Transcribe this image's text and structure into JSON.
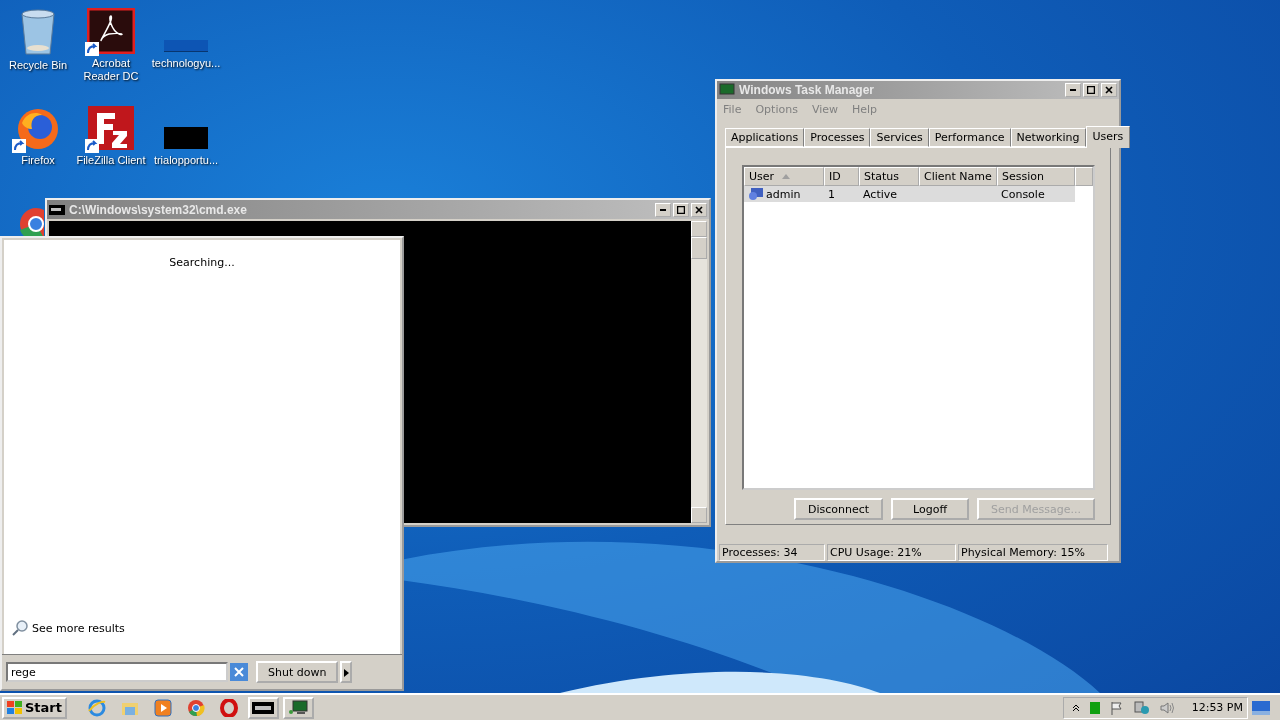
{
  "desktop_icons": [
    {
      "label": "Recycle Bin",
      "kind": "recycle",
      "shortcut": false
    },
    {
      "label": "Acrobat Reader DC",
      "kind": "acrobat",
      "shortcut": true
    },
    {
      "label": "technologyu...",
      "kind": "blank",
      "shortcut": false
    },
    {
      "label": "Firefox",
      "kind": "firefox",
      "shortcut": true
    },
    {
      "label": "FileZilla Client",
      "kind": "filezilla",
      "shortcut": true
    },
    {
      "label": "trialopportu...",
      "kind": "dark",
      "shortcut": false
    }
  ],
  "cmd_window": {
    "title": "C:\\Windows\\system32\\cmd.exe"
  },
  "task_manager": {
    "title": "Windows Task Manager",
    "menu": [
      "File",
      "Options",
      "View",
      "Help"
    ],
    "tabs": [
      {
        "label": "Applications",
        "selected": false
      },
      {
        "label": "Processes",
        "selected": false
      },
      {
        "label": "Services",
        "selected": false
      },
      {
        "label": "Performance",
        "selected": false
      },
      {
        "label": "Networking",
        "selected": false
      },
      {
        "label": "Users",
        "selected": true
      }
    ],
    "columns": [
      "User",
      "ID",
      "Status",
      "Client Name",
      "Session"
    ],
    "rows": [
      {
        "user": "admin",
        "id": "1",
        "status": "Active",
        "session": "Console",
        "selected": true
      }
    ],
    "buttons": [
      {
        "label": "Disconnect",
        "disabled": false
      },
      {
        "label": "Logoff",
        "disabled": false
      },
      {
        "label": "Send Message...",
        "disabled": true
      }
    ],
    "status_bar": [
      "Processes: 34",
      "CPU Usage: 21%",
      "Physical Memory: 15%"
    ]
  },
  "start_menu": {
    "status": "Searching...",
    "more_results": "See more results",
    "search": {
      "value": "rege"
    },
    "shutdown": "Shut down"
  },
  "taskbar": {
    "start": "Start",
    "apps": [
      {
        "kind": "ie",
        "open": false
      },
      {
        "kind": "explorer",
        "open": false
      },
      {
        "kind": "media",
        "open": false
      },
      {
        "kind": "chrome",
        "open": false
      },
      {
        "kind": "opera",
        "open": false
      },
      {
        "kind": "cmd",
        "open": true
      },
      {
        "kind": "taskmgr",
        "open": true
      }
    ],
    "clock": "12:53 PM"
  }
}
